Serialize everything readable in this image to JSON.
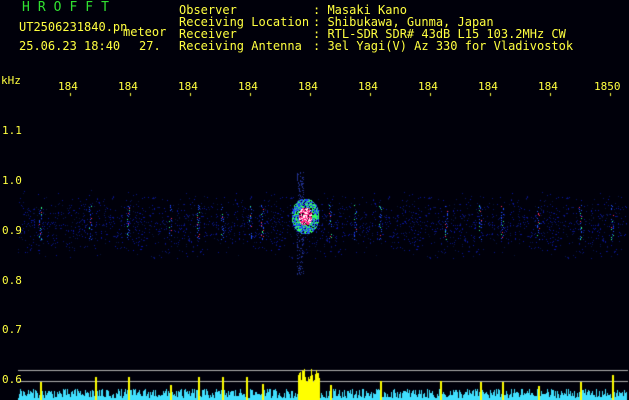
{
  "header": {
    "app_name": "HROFFT",
    "file_name": "UT2506231840.pn",
    "mode": "meteor",
    "datetime": "25.06.23 18:40",
    "counter": "27.",
    "info_labels": [
      "Observer",
      "Receiving Location",
      "Receiver",
      "Receiving Antenna"
    ],
    "info_values": [
      ": Masaki Kano",
      ": Shibukawa, Gunma, Japan",
      ": RTL-SDR SDR# 43dB L15 103.2MHz CW",
      ": 3el Yagi(V) Az 330 for Vladivostok"
    ]
  },
  "axes": {
    "y_unit": "kHz",
    "y_ticks": [
      "1.1",
      "1.0",
      "0.9",
      "0.8",
      "0.7",
      "0.6"
    ],
    "x_ticks": [
      "184",
      "184",
      "184",
      "184",
      "184",
      "184",
      "184",
      "184",
      "184",
      "1850"
    ]
  },
  "colors": {
    "header_text": "#ffff40",
    "app_name": "#30e030",
    "background": "#00000a",
    "trace": "#ffff00",
    "noise": "#40e0ff"
  }
}
